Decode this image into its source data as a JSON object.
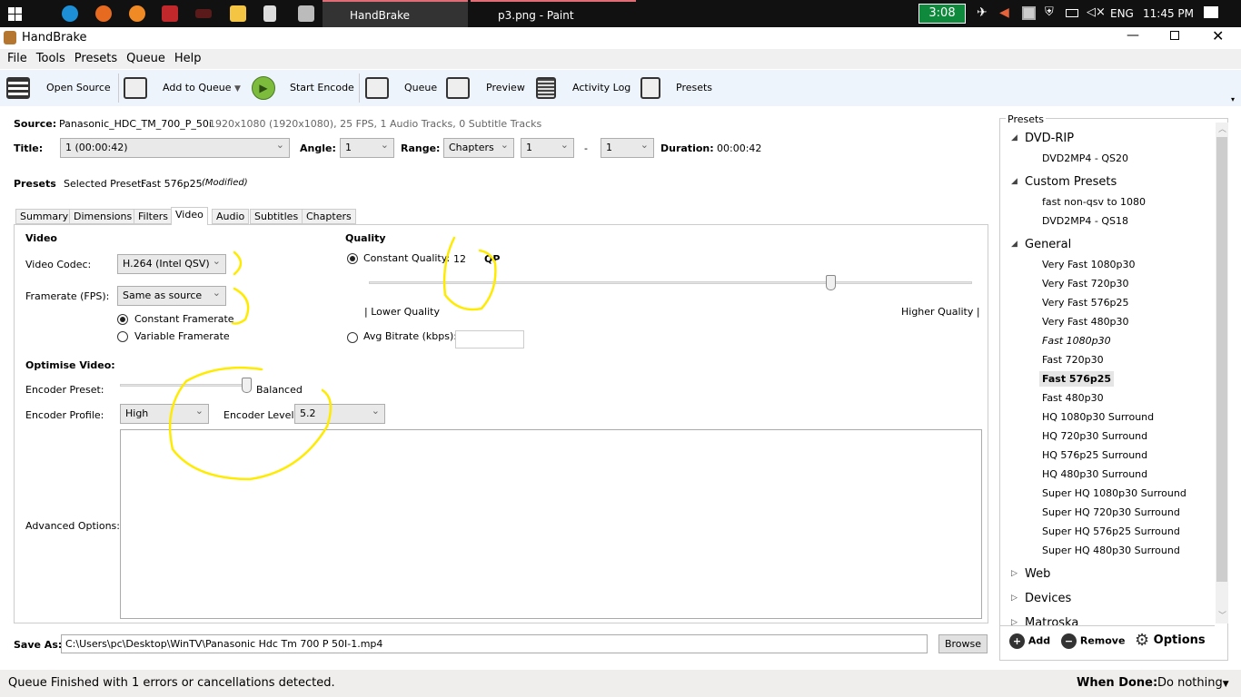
{
  "taskbar": {
    "tabs": [
      "HandBrake",
      "p3.png - Paint"
    ],
    "battery_timer": "3:08",
    "language": "ENG",
    "clock": "11:45 PM"
  },
  "window": {
    "title": "HandBrake"
  },
  "menu": [
    "File",
    "Tools",
    "Presets",
    "Queue",
    "Help"
  ],
  "toolbar": {
    "open_source": "Open Source",
    "add_to_queue": "Add to Queue",
    "start_encode": "Start Encode",
    "queue": "Queue",
    "preview": "Preview",
    "activity_log": "Activity Log",
    "presets": "Presets"
  },
  "source": {
    "label": "Source:",
    "name": "Panasonic_HDC_TM_700_P_50i",
    "info": "1920x1080 (1920x1080), 25 FPS, 1 Audio Tracks, 0 Subtitle Tracks"
  },
  "title_row": {
    "title_label": "Title:",
    "title_value": "1 (00:00:42)",
    "angle_label": "Angle:",
    "angle_value": "1",
    "range_label": "Range:",
    "range_value": "Chapters",
    "range_start": "1",
    "dash": "-",
    "range_end": "1",
    "duration_label": "Duration:",
    "duration_value": "00:00:42"
  },
  "preset_row": {
    "label": "Presets",
    "selected_label": "Selected Preset:",
    "selected": "Fast 576p25",
    "modified": "(Modified)"
  },
  "tabs": [
    "Summary",
    "Dimensions",
    "Filters",
    "Video",
    "Audio",
    "Subtitles",
    "Chapters"
  ],
  "active_tab": "Video",
  "video": {
    "section": "Video",
    "codec_label": "Video Codec:",
    "codec": "H.264 (Intel QSV)",
    "framerate_label": "Framerate (FPS):",
    "framerate": "Same as source",
    "constant": "Constant Framerate",
    "variable": "Variable Framerate",
    "framerate_mode": "constant"
  },
  "quality": {
    "section": "Quality",
    "cq_label": "Constant Quality:",
    "cq_value": "12",
    "cq_unit": "QP",
    "slider_fraction": 0.77,
    "lower": "| Lower Quality",
    "higher": "Higher Quality |",
    "avg_label": "Avg Bitrate (kbps):",
    "avg_value": "",
    "mode": "constant"
  },
  "optimise": {
    "section": "Optimise Video:",
    "preset_label": "Encoder Preset:",
    "preset_value": "Balanced",
    "preset_fraction": 1.0,
    "profile_label": "Encoder Profile:",
    "profile": "High",
    "level_label": "Encoder Level:",
    "level": "5.2",
    "advanced_label": "Advanced Options:",
    "advanced_value": ""
  },
  "save": {
    "label": "Save As:",
    "path": "C:\\Users\\pc\\Desktop\\WinTV\\Panasonic Hdc Tm 700 P 50I-1.mp4",
    "browse": "Browse"
  },
  "presets_panel": {
    "title": "Presets",
    "groups": [
      {
        "name": "DVD-RIP",
        "expanded": true,
        "items": [
          "DVD2MP4 - QS20"
        ]
      },
      {
        "name": "Custom Presets",
        "expanded": true,
        "items": [
          "fast non-qsv to 1080",
          "DVD2MP4 - QS18"
        ]
      },
      {
        "name": "General",
        "expanded": true,
        "items": [
          "Very Fast 1080p30",
          "Very Fast 720p30",
          "Very Fast 576p25",
          "Very Fast 480p30",
          "Fast 1080p30",
          "Fast 720p30",
          "Fast 576p25",
          "Fast 480p30",
          "HQ 1080p30 Surround",
          "HQ 720p30 Surround",
          "HQ 576p25 Surround",
          "HQ 480p30 Surround",
          "Super HQ 1080p30 Surround",
          "Super HQ 720p30 Surround",
          "Super HQ 576p25 Surround",
          "Super HQ 480p30 Surround"
        ]
      },
      {
        "name": "Web",
        "expanded": false,
        "items": []
      },
      {
        "name": "Devices",
        "expanded": false,
        "items": []
      },
      {
        "name": "Matroska",
        "expanded": false,
        "items": []
      }
    ],
    "selected": "Fast 576p25",
    "italic": "Fast 1080p30",
    "add": "Add",
    "remove": "Remove",
    "options": "Options"
  },
  "status": {
    "message": "Queue Finished with 1 errors or cancellations detected.",
    "when_done_label": "When Done:",
    "when_done_value": "Do nothing"
  },
  "colors": {
    "annotation": "#ffeb00",
    "toolbar_bg": "#eef4fb",
    "selected_preset_bg": "#e5e5e5"
  }
}
